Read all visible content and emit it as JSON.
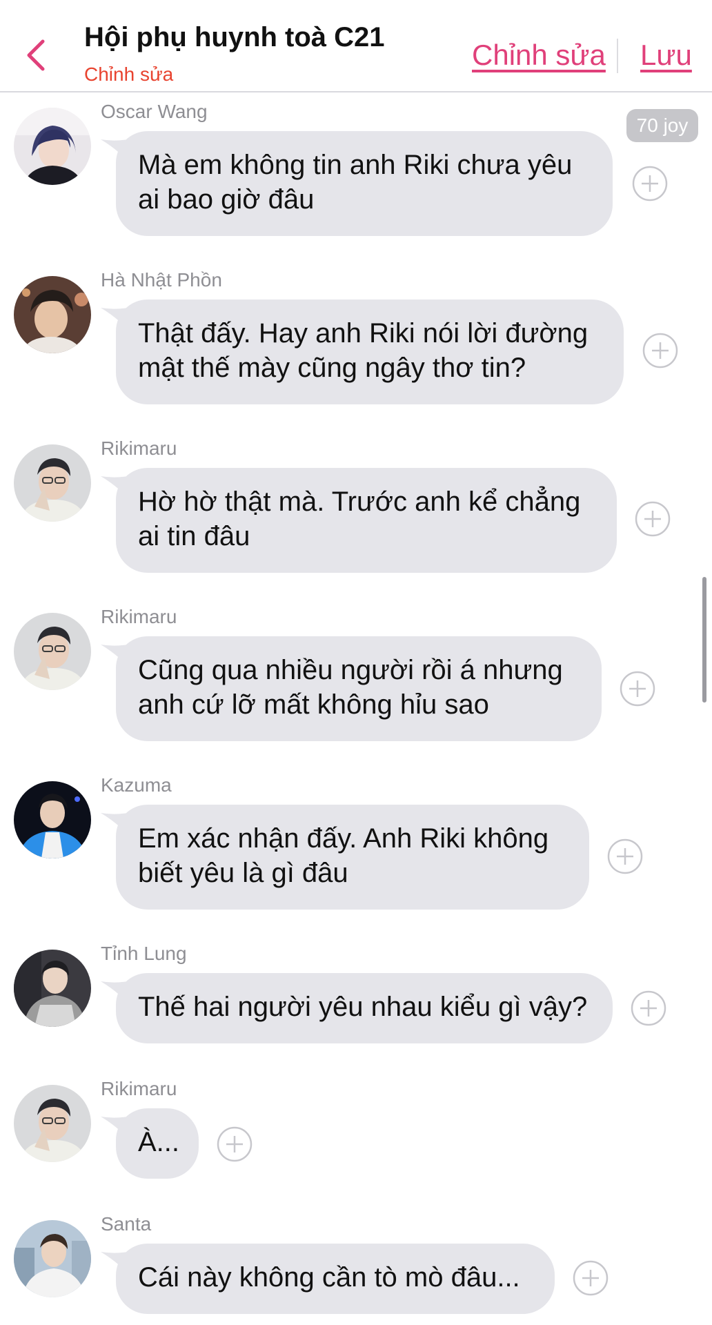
{
  "header": {
    "title": "Hội phụ huynh toà C21",
    "subtitle": "Chỉnh sửa",
    "edit_label": "Chỉnh sửa",
    "save_label": "Lưu",
    "accent": "#e0407a",
    "subtitle_color": "#e8432f",
    "back_icon": "chevron-left-icon"
  },
  "joy_badge": "70 joy",
  "messages": [
    {
      "sender": "Oscar Wang",
      "text": "Mà em không tin anh Riki chưa yêu\nai bao giờ đâu"
    },
    {
      "sender": "Hà Nhật Phồn",
      "text": "Thật đấy. Hay anh Riki nói lời đường\nmật thế mày cũng ngây thơ tin?"
    },
    {
      "sender": "Rikimaru",
      "text": "Hờ hờ thật mà. Trước anh kể chẳng\nai tin đâu"
    },
    {
      "sender": "Rikimaru",
      "text": "Cũng qua nhiều người rồi á nhưng\nanh cứ lỡ mất không hỉu sao"
    },
    {
      "sender": "Kazuma",
      "text": "Em xác nhận đấy. Anh Riki không\nbiết yêu là gì đâu"
    },
    {
      "sender": "Tỉnh Lung",
      "text": "Thế hai người yêu nhau kiểu gì vậy?"
    },
    {
      "sender": "Rikimaru",
      "text": "À..."
    },
    {
      "sender": "Santa",
      "text": "Cái này không cần tò mò đâu..."
    }
  ],
  "colors": {
    "bubble": "#e5e5ea",
    "sender_name": "#8e8e93",
    "add_icon": "#c7c7cc"
  },
  "icons": {
    "add": "plus-circle-icon"
  }
}
